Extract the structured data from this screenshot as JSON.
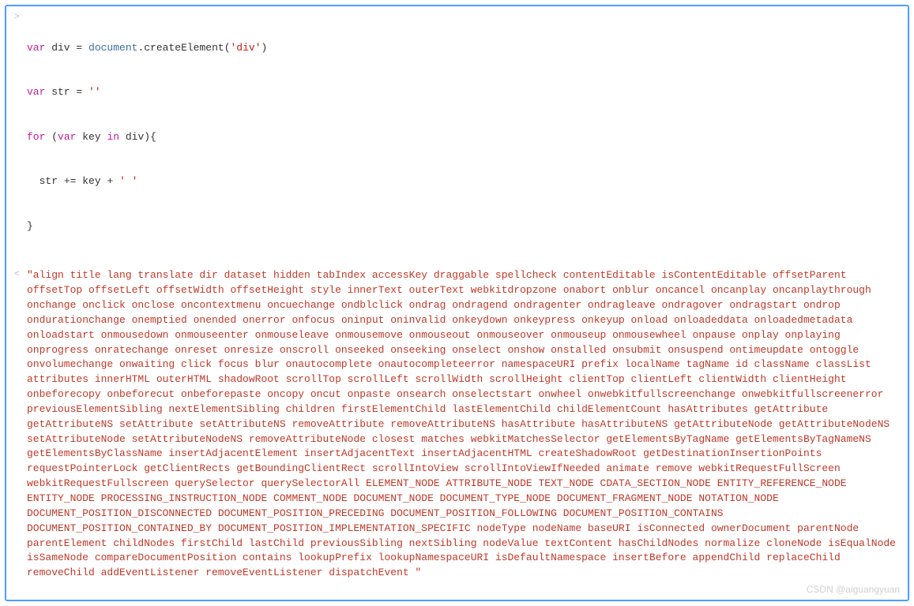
{
  "gutter": {
    "input": ">",
    "output": "<"
  },
  "code": {
    "line1": {
      "kw_var": "var",
      "name_div": " div ",
      "op_eq": "= ",
      "obj_document": "document",
      "dot": ".",
      "fn_create": "createElement",
      "paren_open": "(",
      "str_div": "'div'",
      "paren_close": ")"
    },
    "line2": {
      "kw_var": "var",
      "name_str": " str ",
      "op_eq": "= ",
      "str_empty": "''"
    },
    "line3": {
      "kw_for": "for",
      "space1": " ",
      "paren_open": "(",
      "kw_var": "var",
      "name_key": " key ",
      "kw_in": "in",
      "name_div": " div",
      "paren_close": ")",
      "brace_open": "{"
    },
    "line4": {
      "indent": "  ",
      "name_str": "str ",
      "op_pluseq": "+= ",
      "name_key": "key ",
      "op_plus": "+ ",
      "str_space": "' '"
    },
    "line5": {
      "brace_close": "}"
    }
  },
  "output": "\"align title lang translate dir dataset hidden tabIndex accessKey draggable spellcheck contentEditable isContentEditable offsetParent offsetTop offsetLeft offsetWidth offsetHeight style innerText outerText webkitdropzone onabort onblur oncancel oncanplay oncanplaythrough onchange onclick onclose oncontextmenu oncuechange ondblclick ondrag ondragend ondragenter ondragleave ondragover ondragstart ondrop ondurationchange onemptied onended onerror onfocus oninput oninvalid onkeydown onkeypress onkeyup onload onloadeddata onloadedmetadata onloadstart onmousedown onmouseenter onmouseleave onmousemove onmouseout onmouseover onmouseup onmousewheel onpause onplay onplaying onprogress onratechange onreset onresize onscroll onseeked onseeking onselect onshow onstalled onsubmit onsuspend ontimeupdate ontoggle onvolumechange onwaiting click focus blur onautocomplete onautocompleteerror namespaceURI prefix localName tagName id className classList attributes innerHTML outerHTML shadowRoot scrollTop scrollLeft scrollWidth scrollHeight clientTop clientLeft clientWidth clientHeight onbeforecopy onbeforecut onbeforepaste oncopy oncut onpaste onsearch onselectstart onwheel onwebkitfullscreenchange onwebkitfullscreenerror previousElementSibling nextElementSibling children firstElementChild lastElementChild childElementCount hasAttributes getAttribute getAttributeNS setAttribute setAttributeNS removeAttribute removeAttributeNS hasAttribute hasAttributeNS getAttributeNode getAttributeNodeNS setAttributeNode setAttributeNodeNS removeAttributeNode closest matches webkitMatchesSelector getElementsByTagName getElementsByTagNameNS getElementsByClassName insertAdjacentElement insertAdjacentText insertAdjacentHTML createShadowRoot getDestinationInsertionPoints requestPointerLock getClientRects getBoundingClientRect scrollIntoView scrollIntoViewIfNeeded animate remove webkitRequestFullScreen webkitRequestFullscreen querySelector querySelectorAll ELEMENT_NODE ATTRIBUTE_NODE TEXT_NODE CDATA_SECTION_NODE ENTITY_REFERENCE_NODE ENTITY_NODE PROCESSING_INSTRUCTION_NODE COMMENT_NODE DOCUMENT_NODE DOCUMENT_TYPE_NODE DOCUMENT_FRAGMENT_NODE NOTATION_NODE DOCUMENT_POSITION_DISCONNECTED DOCUMENT_POSITION_PRECEDING DOCUMENT_POSITION_FOLLOWING DOCUMENT_POSITION_CONTAINS DOCUMENT_POSITION_CONTAINED_BY DOCUMENT_POSITION_IMPLEMENTATION_SPECIFIC nodeType nodeName baseURI isConnected ownerDocument parentNode parentElement childNodes firstChild lastChild previousSibling nextSibling nodeValue textContent hasChildNodes normalize cloneNode isEqualNode isSameNode compareDocumentPosition contains lookupPrefix lookupNamespaceURI isDefaultNamespace insertBefore appendChild replaceChild removeChild addEventListener removeEventListener dispatchEvent \"",
  "watermark": "CSDN @aiguangyuan"
}
